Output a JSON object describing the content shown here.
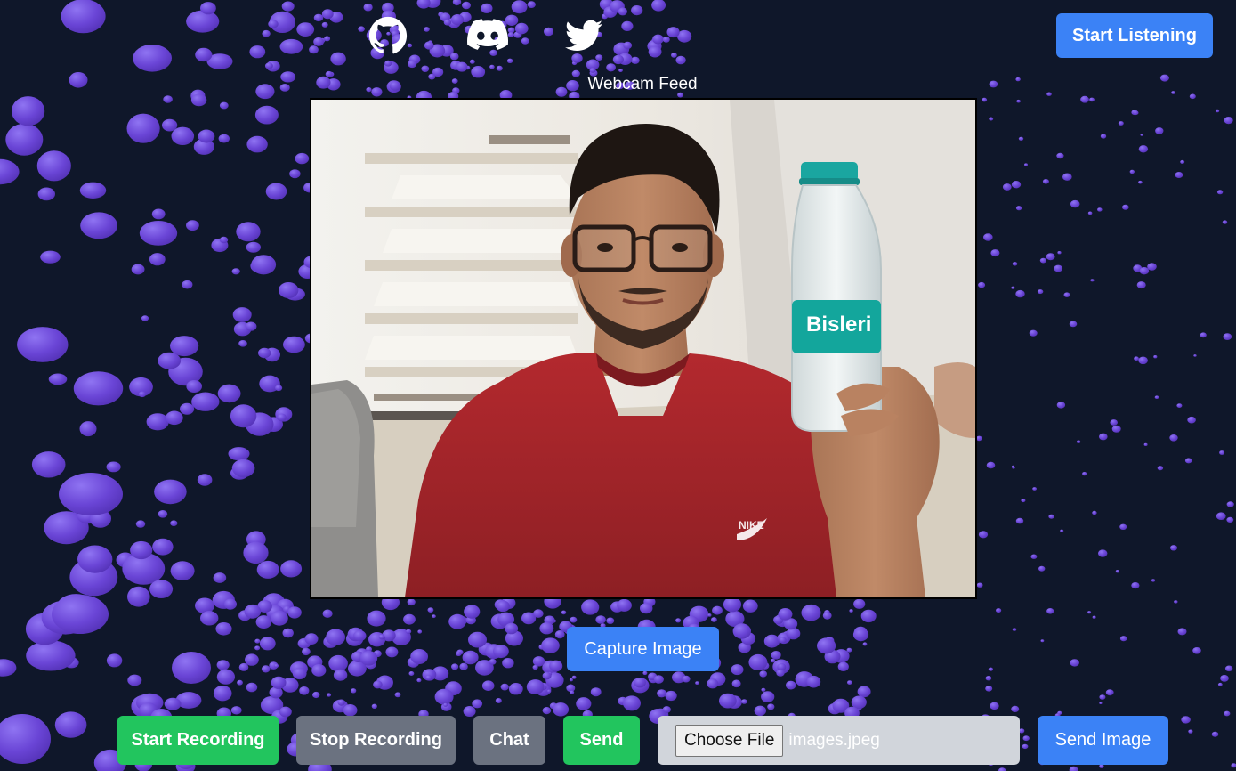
{
  "header": {
    "social_icons": [
      "github-icon",
      "discord-icon",
      "twitter-icon"
    ],
    "start_listening_label": "Start Listening"
  },
  "webcam": {
    "label": "Webcam Feed",
    "capture_label": "Capture Image",
    "bottle_brand_text": "Bisleri",
    "shirt_logo_text": "NIKE"
  },
  "controls": {
    "start_recording_label": "Start Recording",
    "stop_recording_label": "Stop Recording",
    "chat_label": "Chat",
    "send_label": "Send",
    "choose_file_label": "Choose File",
    "file_name": "images.jpeg",
    "send_image_label": "Send Image"
  },
  "colors": {
    "background": "#0f172a",
    "particle": "#6d4ed8",
    "primary_button": "#3b82f6",
    "success_button": "#22c55e",
    "secondary_button": "#6b7280",
    "file_input_bg": "#d1d5db"
  }
}
